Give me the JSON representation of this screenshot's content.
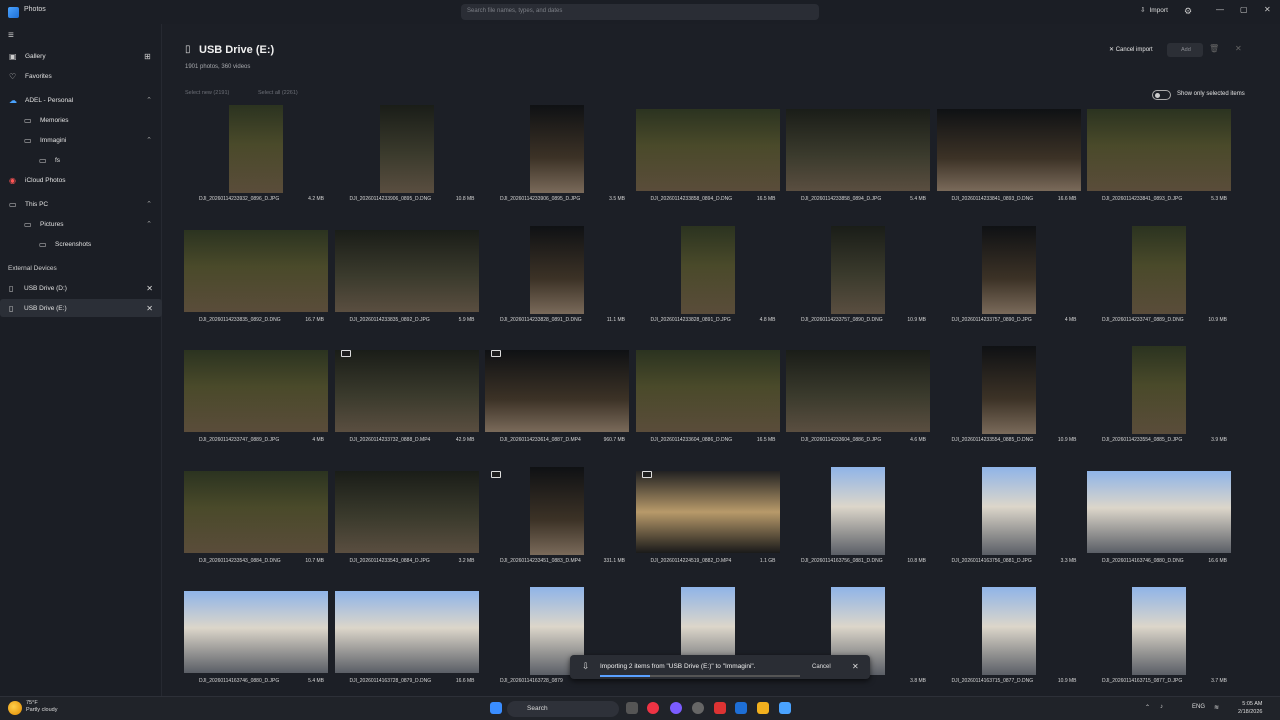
{
  "app": {
    "title": "Photos"
  },
  "search": {
    "placeholder": "Search file names, types, and dates"
  },
  "header": {
    "import_label": "Import"
  },
  "sidebar": {
    "items": [
      {
        "label": "Gallery"
      },
      {
        "label": "Favorites"
      },
      {
        "label": "ADEL - Personal"
      },
      {
        "label": "Memories"
      },
      {
        "label": "Immagini"
      },
      {
        "label": "fs"
      },
      {
        "label": "iCloud Photos"
      },
      {
        "label": "This PC"
      },
      {
        "label": "Pictures"
      },
      {
        "label": "Screenshots"
      }
    ],
    "external_label": "External Devices",
    "devices": [
      {
        "label": "USB Drive (D:)"
      },
      {
        "label": "USB Drive (E:)"
      }
    ]
  },
  "main": {
    "title": "USB Drive (E:)",
    "subtitle": "1901 photos, 360 videos",
    "select_new": "Select new (2191)",
    "select_all": "Select all (2261)",
    "cancel_import": "Cancel import",
    "add_label": "Add",
    "toggle_label": "Show only selected items"
  },
  "tiles": [
    {
      "name": "DJI_20260114233932_0896_D.JPG",
      "size": "4.2 MB"
    },
    {
      "name": "DJI_20260114233906_0895_D.DNG",
      "size": "10.8 MB"
    },
    {
      "name": "DJI_20260114233906_0895_D.JPG",
      "size": "3.5 MB"
    },
    {
      "name": "DJI_20260114233858_0894_D.DNG",
      "size": "16.5 MB"
    },
    {
      "name": "DJI_20260114233858_0894_D.JPG",
      "size": "5.4 MB"
    },
    {
      "name": "DJI_20260114233841_0893_D.DNG",
      "size": "16.6 MB"
    },
    {
      "name": "DJI_20260114233841_0893_D.JPG",
      "size": "5.3 MB"
    },
    {
      "name": "DJI_20260114233835_0892_D.DNG",
      "size": "16.7 MB"
    },
    {
      "name": "DJI_20260114233835_0892_D.JPG",
      "size": "5.9 MB"
    },
    {
      "name": "DJI_20260114233828_0891_D.DNG",
      "size": "11.1 MB"
    },
    {
      "name": "DJI_20260114233828_0891_D.JPG",
      "size": "4.8 MB"
    },
    {
      "name": "DJI_20260114233757_0890_D.DNG",
      "size": "10.9 MB"
    },
    {
      "name": "DJI_20260114233757_0890_D.JPG",
      "size": "4 MB"
    },
    {
      "name": "DJI_20260114233747_0889_D.DNG",
      "size": "10.9 MB"
    },
    {
      "name": "DJI_20260114233747_0889_D.JPG",
      "size": "4 MB"
    },
    {
      "name": "DJI_20260114233732_0888_D.MP4",
      "size": "42.9 MB"
    },
    {
      "name": "DJI_20260114233614_0887_D.MP4",
      "size": "960.7 MB"
    },
    {
      "name": "DJI_20260114233604_0886_D.DNG",
      "size": "16.5 MB"
    },
    {
      "name": "DJI_20260114233604_0886_D.JPG",
      "size": "4.6 MB"
    },
    {
      "name": "DJI_20260114233554_0885_D.DNG",
      "size": "10.9 MB"
    },
    {
      "name": "DJI_20260114233554_0885_D.JPG",
      "size": "3.9 MB"
    },
    {
      "name": "DJI_20260114233543_0884_D.DNG",
      "size": "10.7 MB"
    },
    {
      "name": "DJI_20260114233543_0884_D.JPG",
      "size": "3.2 MB"
    },
    {
      "name": "DJI_20260114233451_0883_D.MP4",
      "size": "331.1 MB"
    },
    {
      "name": "DJI_20260114224519_0882_D.MP4",
      "size": "1.1 GB"
    },
    {
      "name": "DJI_20260114163756_0881_D.DNG",
      "size": "10.8 MB"
    },
    {
      "name": "DJI_20260114163756_0881_D.JPG",
      "size": "3.3 MB"
    },
    {
      "name": "DJI_20260114163746_0880_D.DNG",
      "size": "16.6 MB"
    },
    {
      "name": "DJI_20260114163746_0880_D.JPG",
      "size": "5.4 MB"
    },
    {
      "name": "DJI_20260114163728_0879_D.DNG",
      "size": "16.6 MB"
    },
    {
      "name": "DJI_20260114163728_0879",
      "size": ""
    },
    {
      "name": "",
      "size": ""
    },
    {
      "name": "",
      "size": "3.8 MB"
    },
    {
      "name": "DJI_20260114163715_0877_D.DNG",
      "size": "10.9 MB"
    },
    {
      "name": "DJI_20260114163715_0877_D.JPG",
      "size": "3.7 MB"
    }
  ],
  "toast": {
    "text": "Importing 2 items from \"USB Drive (E:)\" to \"Immagini\".",
    "cancel": "Cancel",
    "progress": 0.25
  },
  "taskbar": {
    "weather_temp": "75°F",
    "weather_desc": "Partly cloudy",
    "search_label": "Search",
    "lang": "ENG",
    "time": "5:05 AM",
    "date": "2/18/2026"
  }
}
